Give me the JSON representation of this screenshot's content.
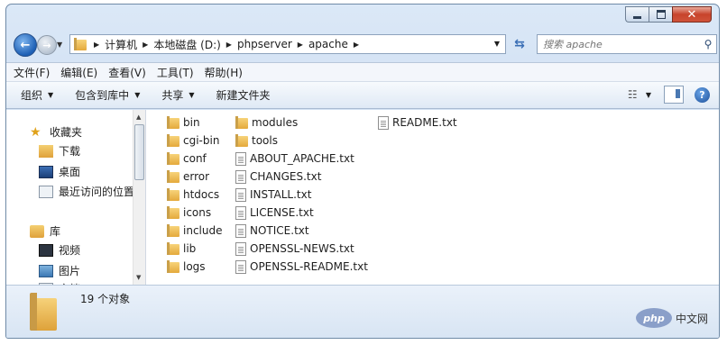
{
  "window": {
    "caption_buttons": {
      "minimize": "",
      "maximize": "",
      "close": "✕"
    }
  },
  "address": {
    "crumbs": [
      "计算机",
      "本地磁盘 (D:)",
      "phpserver",
      "apache"
    ]
  },
  "search": {
    "placeholder": "搜索 apache"
  },
  "menu": [
    "文件(F)",
    "编辑(E)",
    "查看(V)",
    "工具(T)",
    "帮助(H)"
  ],
  "toolbar": {
    "organize": "组织",
    "include_in_library": "包含到库中",
    "share": "共享",
    "new_folder": "新建文件夹"
  },
  "navpane": {
    "favorites": "收藏夹",
    "downloads": "下载",
    "desktop": "桌面",
    "recent": "最近访问的位置",
    "libraries": "库",
    "videos": "视频",
    "pictures": "图片",
    "documents": "文档"
  },
  "files": {
    "col1": [
      "bin",
      "cgi-bin",
      "conf",
      "error",
      "htdocs",
      "icons",
      "include",
      "lib",
      "logs"
    ],
    "col2_folders": [
      "modules",
      "tools"
    ],
    "col2_files": [
      "ABOUT_APACHE.txt",
      "CHANGES.txt",
      "INSTALL.txt",
      "LICENSE.txt",
      "NOTICE.txt",
      "OPENSSL-NEWS.txt",
      "OPENSSL-README.txt"
    ],
    "col3_files": [
      "README.txt"
    ]
  },
  "details": {
    "count": "19 个对象"
  },
  "watermark": {
    "logo": "php",
    "text": "中文网"
  },
  "colors": {
    "accent": "#1d5fb5",
    "folder": "#e4a93c"
  },
  "icons": {
    "back": "back-arrow-icon",
    "forward": "forward-arrow-icon",
    "refresh": "refresh-icon",
    "search": "search-icon",
    "help": "help-icon"
  }
}
